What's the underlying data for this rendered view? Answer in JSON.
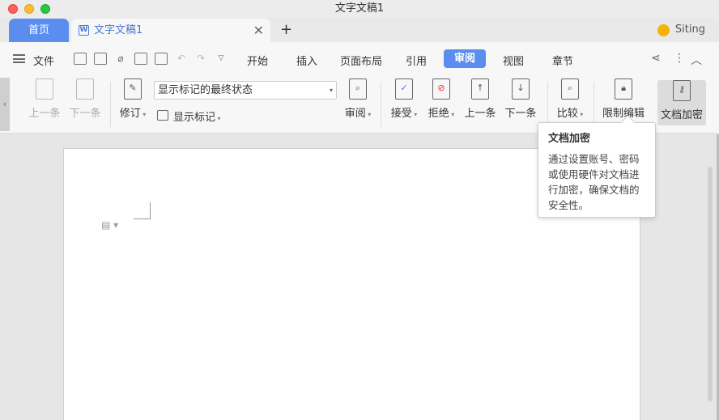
{
  "window": {
    "title": "文字文稿1"
  },
  "tabs": {
    "home": "首页",
    "doc": "文字文稿1",
    "add": "+",
    "close": "✕"
  },
  "user": {
    "name": "Siting"
  },
  "menu": {
    "file": "文件",
    "tabs": [
      "开始",
      "插入",
      "页面布局",
      "引用",
      "审阅",
      "视图",
      "章节"
    ],
    "active": "审阅"
  },
  "ribbon": {
    "prev_disabled": "上一条",
    "next_disabled": "下一条",
    "revise": "修订",
    "markup_state": "显示标记的最终状态",
    "show_markup": "显示标记",
    "review": "审阅",
    "accept": "接受",
    "reject": "拒绝",
    "prev": "上一条",
    "next": "下一条",
    "compare": "比较",
    "restrict_edit": "限制编辑",
    "doc_encrypt": "文档加密"
  },
  "tooltip": {
    "title": "文档加密",
    "body": "通过设置账号、密码或使用硬件对文档进行加密，确保文档的安全性。"
  },
  "colors": {
    "accent": "#5b8def"
  }
}
